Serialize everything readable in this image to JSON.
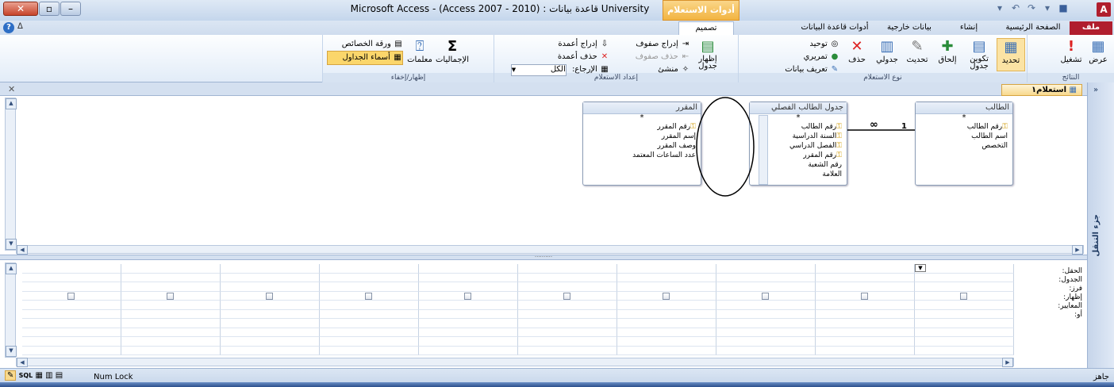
{
  "window": {
    "title": "Microsoft Access - (Access 2007 - 2010) : قاعدة بيانات University",
    "contextual_tab_group": "أدوات الاستعلام",
    "logo_letter": "A"
  },
  "tabs": [
    "ملف",
    "الصفحة الرئيسية",
    "إنشاء",
    "بيانات خارجية",
    "أدوات قاعدة البيانات",
    "تصميم"
  ],
  "ribbon": {
    "results": {
      "label": "النتائج",
      "view": "عرض",
      "run": "تشغيل"
    },
    "query_type": {
      "label": "نوع الاستعلام",
      "select": "تحديد",
      "make_table": "تكوين جدول",
      "append": "إلحاق",
      "update": "تحديث",
      "crosstab": "جدولي",
      "delete": "حذف",
      "union": "توحيد",
      "pass_through": "تمريري",
      "data_definition": "تعريف بيانات"
    },
    "query_setup": {
      "label": "إعداد الاستعلام",
      "show_table": "إظهار جدول",
      "insert_rows": "إدراج صفوف",
      "delete_rows": "حذف صفوف",
      "builder": "منشئ",
      "insert_columns": "إدراج أعمدة",
      "delete_columns": "حذف أعمدة",
      "return_label": "الإرجاع:",
      "return_value": "الكل"
    },
    "show_hide": {
      "label": "إظهار/إخفاء",
      "totals": "الإجماليات",
      "parameters": "معلمات",
      "property_sheet": "ورقة الخصائص",
      "table_names": "أسماء الجداول"
    }
  },
  "document": {
    "tab_label": "استعلام١",
    "nav_pane_label": "جزء التنقل"
  },
  "tables": {
    "student": {
      "title": "الطالب",
      "star": "*",
      "fields": [
        "رقم الطالب",
        "اسم الطالب",
        "التخصص"
      ]
    },
    "enrollment": {
      "title": "جدول الطالب الفصلي",
      "star": "*",
      "fields": [
        "رقم الطالب",
        "السنة الدراسية",
        "الفصل الدراسي",
        "رقم المقرر",
        "رقم الشعبة",
        "العلامة"
      ]
    },
    "course": {
      "title": "المقرر",
      "star": "*",
      "fields": [
        "رقم المقرر",
        "إسم المقرر",
        "وصف المقرر",
        "عدد الساعات المعتمد"
      ]
    },
    "relationship": {
      "one_label": "1",
      "many_label": "∞"
    }
  },
  "grid": {
    "row_labels": [
      "الحقل:",
      "الجدول:",
      "فرز:",
      "إظهار:",
      "المعايير:",
      "أو:"
    ],
    "column_count": 10
  },
  "status": {
    "ready": "جاهز",
    "num_lock": "Num Lock",
    "sql_label": "SQL"
  },
  "colors": {
    "file_tab": "#b01e2e",
    "contextual": "#f2b441",
    "ribbon_bg": "#e2ecf8"
  }
}
